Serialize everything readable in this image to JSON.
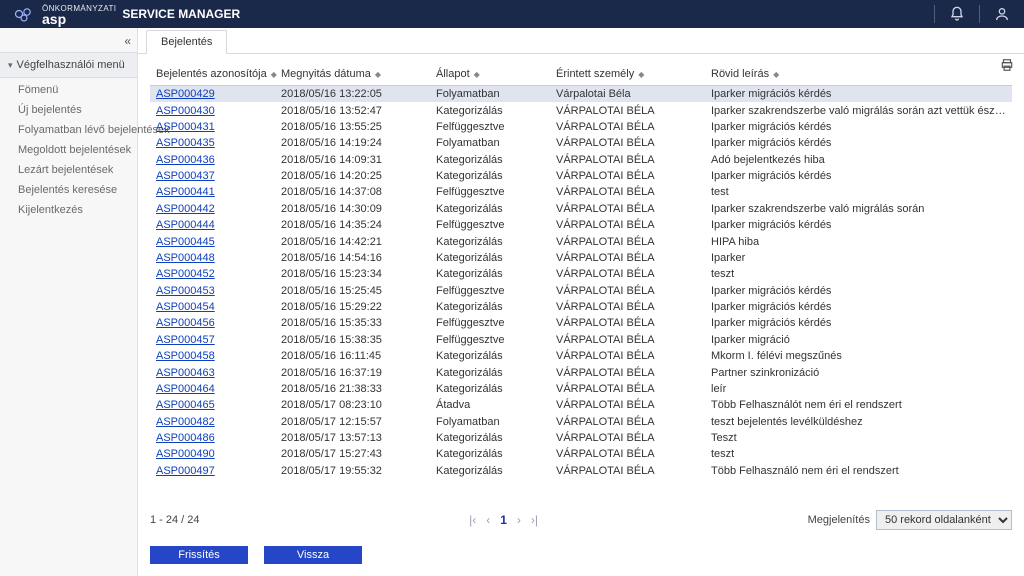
{
  "header": {
    "brand_top": "ÖNKORMÁNYZATI",
    "brand_main": "asp",
    "app_title": "SERVICE MANAGER"
  },
  "sidebar": {
    "menu_title": "Végfelhasználói menü",
    "items": [
      {
        "label": "Fömenü"
      },
      {
        "label": "Új bejelentés"
      },
      {
        "label": "Folyamatban lévő bejelentések"
      },
      {
        "label": "Megoldott bejelentések"
      },
      {
        "label": "Lezárt bejelentések"
      },
      {
        "label": "Bejelentés keresése"
      },
      {
        "label": "Kijelentkezés"
      }
    ]
  },
  "tabs": {
    "active": "Bejelentés"
  },
  "table": {
    "columns": {
      "id": "Bejelentés azonosítója",
      "date": "Megnyitás dátuma",
      "state": "Állapot",
      "person": "Érintett személy",
      "desc": "Rövid leírás"
    },
    "rows": [
      {
        "id": "ASP000429",
        "date": "2018/05/16 13:22:05",
        "state": "Folyamatban",
        "person": "Várpalotai Béla",
        "desc": "Iparker migrációs kérdés"
      },
      {
        "id": "ASP000430",
        "date": "2018/05/16 13:52:47",
        "state": "Kategorizálás",
        "person": "VÁRPALOTAI BÉLA",
        "desc": "Iparker szakrendszerbe való migrálás során azt vettük észre, hogy a kiadott xsd..."
      },
      {
        "id": "ASP000431",
        "date": "2018/05/16 13:55:25",
        "state": "Felfüggesztve",
        "person": "VÁRPALOTAI BÉLA",
        "desc": "Iparker migrációs kérdés"
      },
      {
        "id": "ASP000435",
        "date": "2018/05/16 14:19:24",
        "state": "Folyamatban",
        "person": "VÁRPALOTAI BÉLA",
        "desc": "Iparker migrációs kérdés"
      },
      {
        "id": "ASP000436",
        "date": "2018/05/16 14:09:31",
        "state": "Kategorizálás",
        "person": "VÁRPALOTAI BÉLA",
        "desc": "Adó bejelentkezés hiba"
      },
      {
        "id": "ASP000437",
        "date": "2018/05/16 14:20:25",
        "state": "Kategorizálás",
        "person": "VÁRPALOTAI BÉLA",
        "desc": "Iparker migrációs kérdés"
      },
      {
        "id": "ASP000441",
        "date": "2018/05/16 14:37:08",
        "state": "Felfüggesztve",
        "person": "VÁRPALOTAI BÉLA",
        "desc": "test"
      },
      {
        "id": "ASP000442",
        "date": "2018/05/16 14:30:09",
        "state": "Kategorizálás",
        "person": "VÁRPALOTAI BÉLA",
        "desc": "Iparker szakrendszerbe való migrálás során"
      },
      {
        "id": "ASP000444",
        "date": "2018/05/16 14:35:24",
        "state": "Felfüggesztve",
        "person": "VÁRPALOTAI BÉLA",
        "desc": "Iparker migrációs kérdés"
      },
      {
        "id": "ASP000445",
        "date": "2018/05/16 14:42:21",
        "state": "Kategorizálás",
        "person": "VÁRPALOTAI BÉLA",
        "desc": "HIPA hiba"
      },
      {
        "id": "ASP000448",
        "date": "2018/05/16 14:54:16",
        "state": "Kategorizálás",
        "person": "VÁRPALOTAI BÉLA",
        "desc": "Iparker"
      },
      {
        "id": "ASP000452",
        "date": "2018/05/16 15:23:34",
        "state": "Kategorizálás",
        "person": "VÁRPALOTAI BÉLA",
        "desc": "teszt"
      },
      {
        "id": "ASP000453",
        "date": "2018/05/16 15:25:45",
        "state": "Felfüggesztve",
        "person": "VÁRPALOTAI BÉLA",
        "desc": "Iparker migrációs kérdés"
      },
      {
        "id": "ASP000454",
        "date": "2018/05/16 15:29:22",
        "state": "Kategorizálás",
        "person": "VÁRPALOTAI BÉLA",
        "desc": "Iparker migrációs kérdés"
      },
      {
        "id": "ASP000456",
        "date": "2018/05/16 15:35:33",
        "state": "Felfüggesztve",
        "person": "VÁRPALOTAI BÉLA",
        "desc": "Iparker migrációs kérdés"
      },
      {
        "id": "ASP000457",
        "date": "2018/05/16 15:38:35",
        "state": "Felfüggesztve",
        "person": "VÁRPALOTAI BÉLA",
        "desc": "Iparker migráció"
      },
      {
        "id": "ASP000458",
        "date": "2018/05/16 16:11:45",
        "state": "Kategorizálás",
        "person": "VÁRPALOTAI BÉLA",
        "desc": "Mkorm I. félévi megszűnés"
      },
      {
        "id": "ASP000463",
        "date": "2018/05/16 16:37:19",
        "state": "Kategorizálás",
        "person": "VÁRPALOTAI BÉLA",
        "desc": "Partner szinkronizáció"
      },
      {
        "id": "ASP000464",
        "date": "2018/05/16 21:38:33",
        "state": "Kategorizálás",
        "person": "VÁRPALOTAI BÉLA",
        "desc": "leír"
      },
      {
        "id": "ASP000465",
        "date": "2018/05/17 08:23:10",
        "state": "Átadva",
        "person": "VÁRPALOTAI BÉLA",
        "desc": "Több Felhasználót nem éri el rendszert"
      },
      {
        "id": "ASP000482",
        "date": "2018/05/17 12:15:57",
        "state": "Folyamatban",
        "person": "VÁRPALOTAI BÉLA",
        "desc": "teszt bejelentés levélküldéshez"
      },
      {
        "id": "ASP000486",
        "date": "2018/05/17 13:57:13",
        "state": "Kategorizálás",
        "person": "VÁRPALOTAI BÉLA",
        "desc": "Teszt"
      },
      {
        "id": "ASP000490",
        "date": "2018/05/17 15:27:43",
        "state": "Kategorizálás",
        "person": "VÁRPALOTAI BÉLA",
        "desc": "teszt"
      },
      {
        "id": "ASP000497",
        "date": "2018/05/17 19:55:32",
        "state": "Kategorizálás",
        "person": "VÁRPALOTAI BÉLA",
        "desc": "Több Felhasználó nem éri el rendszert"
      }
    ]
  },
  "footer": {
    "range": "1 - 24 / 24",
    "page": "1",
    "pagesize_label": "Megjelenítés",
    "pagesize_value": "50 rekord oldalanként"
  },
  "actions": {
    "refresh": "Frissítés",
    "back": "Vissza"
  }
}
